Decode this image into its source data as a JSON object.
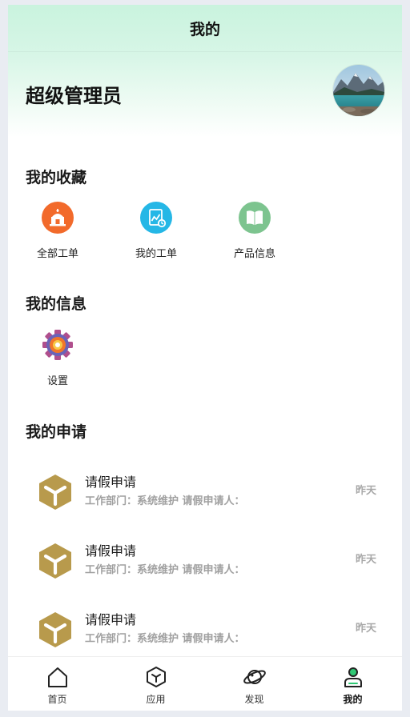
{
  "nav": {
    "title": "我的"
  },
  "profile": {
    "name": "超级管理员"
  },
  "favorites": {
    "title": "我的收藏",
    "items": [
      {
        "label": "全部工单",
        "icon": "building-icon",
        "color": "#f26a2b"
      },
      {
        "label": "我的工单",
        "icon": "chart-doc-icon",
        "color": "#25b7e6"
      },
      {
        "label": "产品信息",
        "icon": "book-icon",
        "color": "#7dc48f"
      }
    ]
  },
  "info": {
    "title": "我的信息",
    "items": [
      {
        "label": "设置",
        "icon": "gear-icon",
        "color": "#b04f8d"
      }
    ]
  },
  "applications": {
    "title": "我的申请",
    "items": [
      {
        "title": "请假申请",
        "subtitle": "工作部门：系统维护 请假申请人：",
        "time": "昨天"
      },
      {
        "title": "请假申请",
        "subtitle": "工作部门：系统维护 请假申请人：",
        "time": "昨天"
      },
      {
        "title": "请假申请",
        "subtitle": "工作部门：系统维护 请假申请人：",
        "time": "昨天"
      }
    ]
  },
  "tabbar": {
    "items": [
      {
        "label": "首页",
        "icon": "home-icon"
      },
      {
        "label": "应用",
        "icon": "cube-icon"
      },
      {
        "label": "发现",
        "icon": "planet-icon"
      },
      {
        "label": "我的",
        "icon": "user-icon",
        "active": true
      }
    ]
  },
  "colors": {
    "accent": "#2fc874",
    "app_icon": "#b89a4c"
  }
}
